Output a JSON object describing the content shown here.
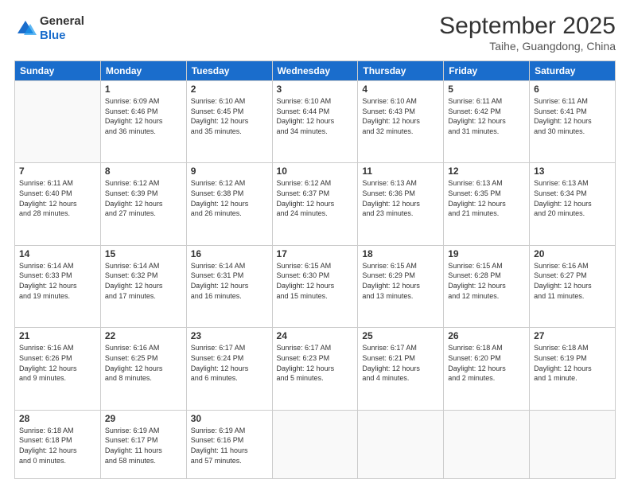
{
  "header": {
    "logo_general": "General",
    "logo_blue": "Blue",
    "month_title": "September 2025",
    "location": "Taihe, Guangdong, China"
  },
  "weekdays": [
    "Sunday",
    "Monday",
    "Tuesday",
    "Wednesday",
    "Thursday",
    "Friday",
    "Saturday"
  ],
  "weeks": [
    [
      {
        "day": "",
        "info": ""
      },
      {
        "day": "1",
        "info": "Sunrise: 6:09 AM\nSunset: 6:46 PM\nDaylight: 12 hours\nand 36 minutes."
      },
      {
        "day": "2",
        "info": "Sunrise: 6:10 AM\nSunset: 6:45 PM\nDaylight: 12 hours\nand 35 minutes."
      },
      {
        "day": "3",
        "info": "Sunrise: 6:10 AM\nSunset: 6:44 PM\nDaylight: 12 hours\nand 34 minutes."
      },
      {
        "day": "4",
        "info": "Sunrise: 6:10 AM\nSunset: 6:43 PM\nDaylight: 12 hours\nand 32 minutes."
      },
      {
        "day": "5",
        "info": "Sunrise: 6:11 AM\nSunset: 6:42 PM\nDaylight: 12 hours\nand 31 minutes."
      },
      {
        "day": "6",
        "info": "Sunrise: 6:11 AM\nSunset: 6:41 PM\nDaylight: 12 hours\nand 30 minutes."
      }
    ],
    [
      {
        "day": "7",
        "info": "Sunrise: 6:11 AM\nSunset: 6:40 PM\nDaylight: 12 hours\nand 28 minutes."
      },
      {
        "day": "8",
        "info": "Sunrise: 6:12 AM\nSunset: 6:39 PM\nDaylight: 12 hours\nand 27 minutes."
      },
      {
        "day": "9",
        "info": "Sunrise: 6:12 AM\nSunset: 6:38 PM\nDaylight: 12 hours\nand 26 minutes."
      },
      {
        "day": "10",
        "info": "Sunrise: 6:12 AM\nSunset: 6:37 PM\nDaylight: 12 hours\nand 24 minutes."
      },
      {
        "day": "11",
        "info": "Sunrise: 6:13 AM\nSunset: 6:36 PM\nDaylight: 12 hours\nand 23 minutes."
      },
      {
        "day": "12",
        "info": "Sunrise: 6:13 AM\nSunset: 6:35 PM\nDaylight: 12 hours\nand 21 minutes."
      },
      {
        "day": "13",
        "info": "Sunrise: 6:13 AM\nSunset: 6:34 PM\nDaylight: 12 hours\nand 20 minutes."
      }
    ],
    [
      {
        "day": "14",
        "info": "Sunrise: 6:14 AM\nSunset: 6:33 PM\nDaylight: 12 hours\nand 19 minutes."
      },
      {
        "day": "15",
        "info": "Sunrise: 6:14 AM\nSunset: 6:32 PM\nDaylight: 12 hours\nand 17 minutes."
      },
      {
        "day": "16",
        "info": "Sunrise: 6:14 AM\nSunset: 6:31 PM\nDaylight: 12 hours\nand 16 minutes."
      },
      {
        "day": "17",
        "info": "Sunrise: 6:15 AM\nSunset: 6:30 PM\nDaylight: 12 hours\nand 15 minutes."
      },
      {
        "day": "18",
        "info": "Sunrise: 6:15 AM\nSunset: 6:29 PM\nDaylight: 12 hours\nand 13 minutes."
      },
      {
        "day": "19",
        "info": "Sunrise: 6:15 AM\nSunset: 6:28 PM\nDaylight: 12 hours\nand 12 minutes."
      },
      {
        "day": "20",
        "info": "Sunrise: 6:16 AM\nSunset: 6:27 PM\nDaylight: 12 hours\nand 11 minutes."
      }
    ],
    [
      {
        "day": "21",
        "info": "Sunrise: 6:16 AM\nSunset: 6:26 PM\nDaylight: 12 hours\nand 9 minutes."
      },
      {
        "day": "22",
        "info": "Sunrise: 6:16 AM\nSunset: 6:25 PM\nDaylight: 12 hours\nand 8 minutes."
      },
      {
        "day": "23",
        "info": "Sunrise: 6:17 AM\nSunset: 6:24 PM\nDaylight: 12 hours\nand 6 minutes."
      },
      {
        "day": "24",
        "info": "Sunrise: 6:17 AM\nSunset: 6:23 PM\nDaylight: 12 hours\nand 5 minutes."
      },
      {
        "day": "25",
        "info": "Sunrise: 6:17 AM\nSunset: 6:21 PM\nDaylight: 12 hours\nand 4 minutes."
      },
      {
        "day": "26",
        "info": "Sunrise: 6:18 AM\nSunset: 6:20 PM\nDaylight: 12 hours\nand 2 minutes."
      },
      {
        "day": "27",
        "info": "Sunrise: 6:18 AM\nSunset: 6:19 PM\nDaylight: 12 hours\nand 1 minute."
      }
    ],
    [
      {
        "day": "28",
        "info": "Sunrise: 6:18 AM\nSunset: 6:18 PM\nDaylight: 12 hours\nand 0 minutes."
      },
      {
        "day": "29",
        "info": "Sunrise: 6:19 AM\nSunset: 6:17 PM\nDaylight: 11 hours\nand 58 minutes."
      },
      {
        "day": "30",
        "info": "Sunrise: 6:19 AM\nSunset: 6:16 PM\nDaylight: 11 hours\nand 57 minutes."
      },
      {
        "day": "",
        "info": ""
      },
      {
        "day": "",
        "info": ""
      },
      {
        "day": "",
        "info": ""
      },
      {
        "day": "",
        "info": ""
      }
    ]
  ]
}
